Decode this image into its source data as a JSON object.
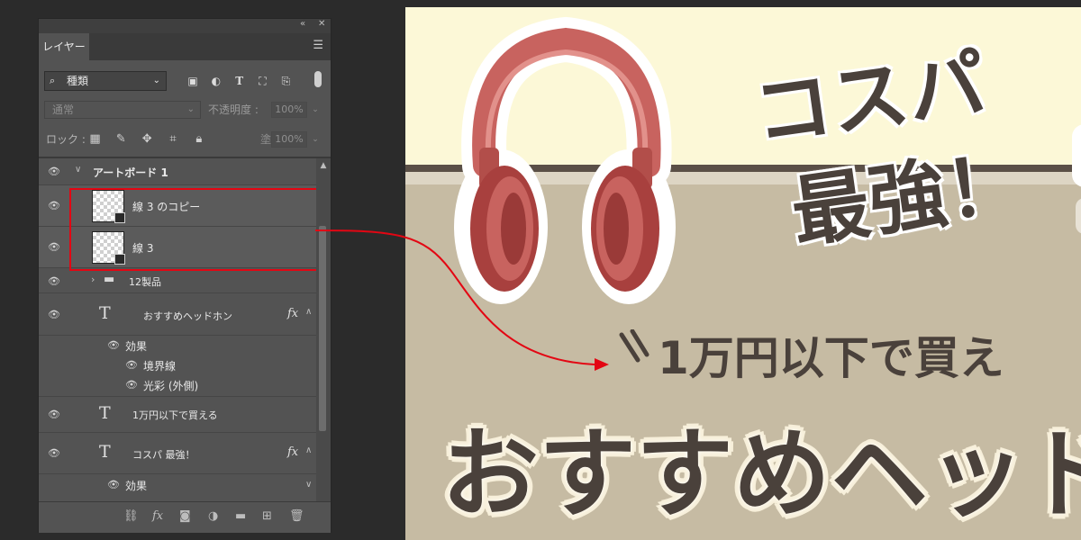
{
  "panel": {
    "title_tab": "レイヤー",
    "filter": {
      "kind_label": "種類"
    },
    "blend_mode": "通常",
    "opacity_label": "不透明度 :",
    "opacity_value": "100%",
    "lock_label": "ロック :",
    "fill_label": "塗り :",
    "fill_value": "100%",
    "layers": {
      "artboard": "アートボード 1",
      "line3_copy": "線 3 のコピー",
      "line3": "線 3",
      "group12": "12製品",
      "text_recommend": "おすすめヘッドホン",
      "effects_label": "効果",
      "stroke_effect": "境界線",
      "outer_glow": "光彩 (外側)",
      "text_under10k": "1万円以下で買える",
      "text_costperf": "コスパ 最強！",
      "effects_label2": "効果"
    }
  },
  "canvas": {
    "catch_line1": "コスパ",
    "catch_line2": "最強！",
    "sub_line": "1万円以下で買え",
    "main_line": "おすすめヘッド"
  },
  "colors": {
    "highlight_red": "#e30613",
    "banner_brown": "#4a413b",
    "cream": "#fcf8d7",
    "beige": "#c6bba3",
    "headphone_red": "#c8635f"
  },
  "icons": [
    "collapse-icon",
    "close-icon",
    "panel-menu-icon",
    "search-icon",
    "eye-icon",
    "folder-icon",
    "text-layer-icon",
    "link-icon",
    "fx-icon",
    "mask-icon",
    "adjustment-icon",
    "new-group-icon",
    "new-layer-icon",
    "trash-icon"
  ]
}
